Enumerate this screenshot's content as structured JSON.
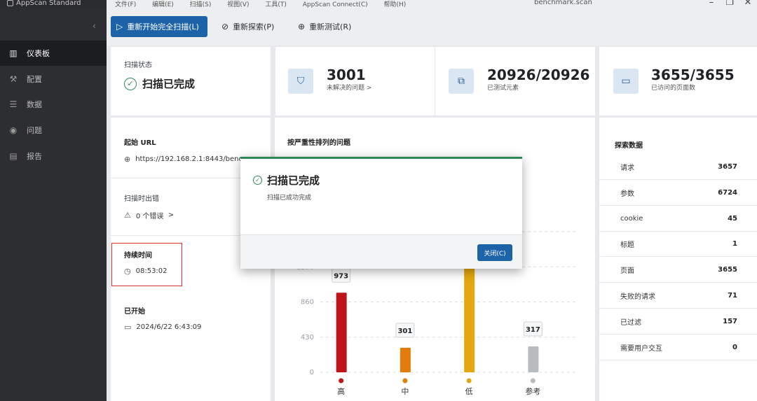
{
  "app": {
    "brand": "AppScan Standard",
    "window_title": "benchmark.scan"
  },
  "menu": [
    "文件(F)",
    "编辑(E)",
    "扫描(S)",
    "视图(V)",
    "工具(T)",
    "AppScan Connect(C)",
    "帮助(H)"
  ],
  "sidebar": {
    "items": [
      {
        "label": "仪表板",
        "icon": "bar-chart-icon",
        "active": true
      },
      {
        "label": "配置",
        "icon": "wrench-icon",
        "active": false
      },
      {
        "label": "数据",
        "icon": "data-icon",
        "active": false
      },
      {
        "label": "问题",
        "icon": "shield-icon",
        "active": false
      },
      {
        "label": "报告",
        "icon": "report-icon",
        "active": false
      }
    ]
  },
  "toolbar": {
    "full_scan": "重新开始完全扫描(L)",
    "rescan_explore": "重新探索(P)",
    "retest": "重新测试(R)"
  },
  "scan_status": {
    "label": "扫描状态",
    "value": "扫描已完成"
  },
  "stats": {
    "issues": {
      "value": "3001",
      "label": "未解决的问题",
      "chevron": ">"
    },
    "elements": {
      "value": "20926/20926",
      "label": "已测试元素"
    },
    "pages": {
      "value": "3655/3655",
      "label": "已访问的页面数"
    }
  },
  "details": {
    "start_url_label": "起始 URL",
    "start_url": "https://192.168.2.1:8443/benc",
    "errors_label": "扫描时出错",
    "errors_value": "0 个错误",
    "errors_chevron": ">",
    "duration_label": "持续时间",
    "duration_value": "08:53:02",
    "started_label": "已开始",
    "started_value": "2024/6/22 6:43:09"
  },
  "chart_data": {
    "type": "bar",
    "title": "按严重性排列的问题",
    "categories": [
      "高",
      "中",
      "低",
      "参考"
    ],
    "values": [
      973,
      301,
      1410,
      317
    ],
    "value_labels": [
      "973",
      "301",
      "",
      "317"
    ],
    "colors": [
      "#c0141b",
      "#e27c0d",
      "#e3a80f",
      "#b8bcc2"
    ],
    "yticks": [
      0,
      430,
      860,
      1290
    ],
    "ylim": [
      0,
      1720
    ],
    "partial_label": "1410"
  },
  "explore": {
    "title": "探索数据",
    "rows": [
      {
        "label": "请求",
        "value": "3657"
      },
      {
        "label": "参数",
        "value": "6724"
      },
      {
        "label": "cookie",
        "value": "45"
      },
      {
        "label": "标题",
        "value": "1"
      },
      {
        "label": "页面",
        "value": "3655"
      },
      {
        "label": "失败的请求",
        "value": "71"
      },
      {
        "label": "已过滤",
        "value": "157"
      },
      {
        "label": "需要用户交互",
        "value": "0"
      }
    ]
  },
  "dialog": {
    "title": "扫描已完成",
    "message": "扫描已成功完成",
    "close": "关闭(C)"
  }
}
